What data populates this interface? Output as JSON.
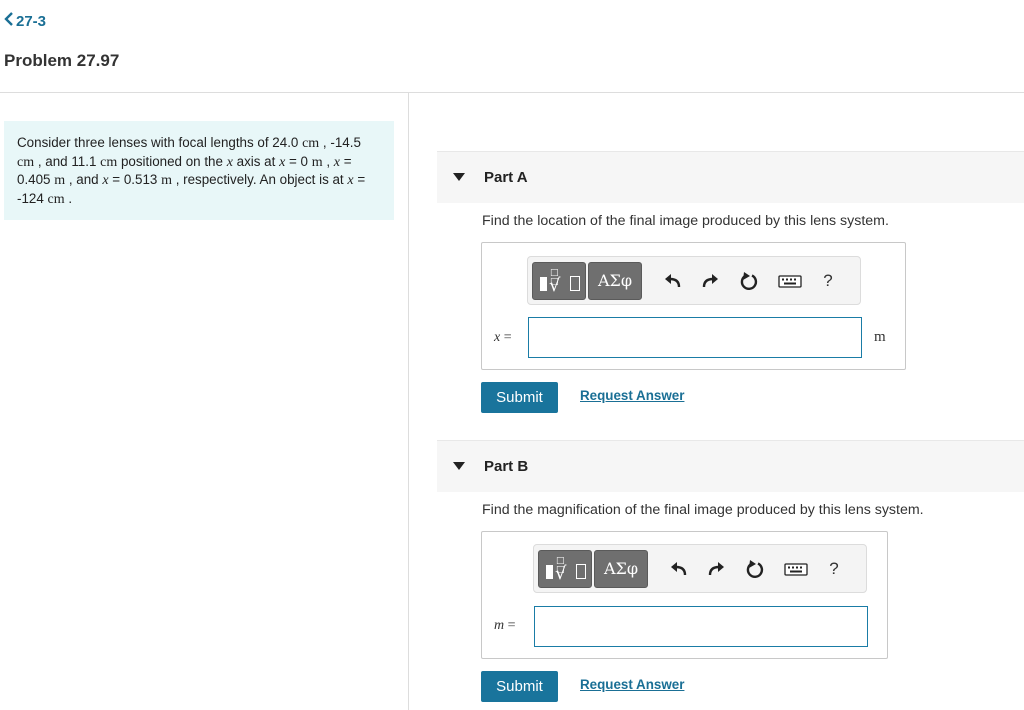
{
  "nav": {
    "back_label": "27-3"
  },
  "problem": {
    "title": "Problem 27.97",
    "statement": {
      "t1": "Consider three lenses with focal lengths of 24.0 ",
      "u1": "cm",
      "t2": " , -14.5 ",
      "u2": "cm",
      "t3": " , and 11.1 ",
      "u3": "cm",
      "t4": " positioned on the ",
      "v1": "x",
      "t5": " axis at ",
      "v2": "x",
      "t6": " = 0 ",
      "u4": "m",
      "t7": " , ",
      "v3": "x",
      "t8": " = 0.405 ",
      "u5": "m",
      "t9": " , and ",
      "v4": "x",
      "t10": " = 0.513 ",
      "u6": "m",
      "t11": " , respectively. An object is at ",
      "v5": "x",
      "t12": " = -124 ",
      "u7": "cm",
      "t13": " ."
    }
  },
  "parts": [
    {
      "label": "Part A",
      "prompt": "Find the location of the final image produced by this lens system.",
      "variable": "x",
      "equals": "=",
      "input_value": "",
      "unit": "m",
      "submit_label": "Submit",
      "request_label": "Request Answer"
    },
    {
      "label": "Part B",
      "prompt": "Find the magnification of the final image produced by this lens system.",
      "variable": "m",
      "equals": "=",
      "input_value": "",
      "unit": "",
      "submit_label": "Submit",
      "request_label": "Request Answer"
    }
  ],
  "toolbar": {
    "templates_icon": "templates-icon",
    "greek_label": "ΑΣφ",
    "undo_icon": "undo-icon",
    "redo_icon": "redo-icon",
    "reset_icon": "reset-icon",
    "keyboard_icon": "keyboard-icon",
    "help_label": "?"
  },
  "colors": {
    "accent": "#19749c",
    "link": "#1a6f95",
    "problem_bg": "#e8f7f8",
    "input_border": "#1a7ca6",
    "toolbar_button": "#6f6f6f"
  }
}
